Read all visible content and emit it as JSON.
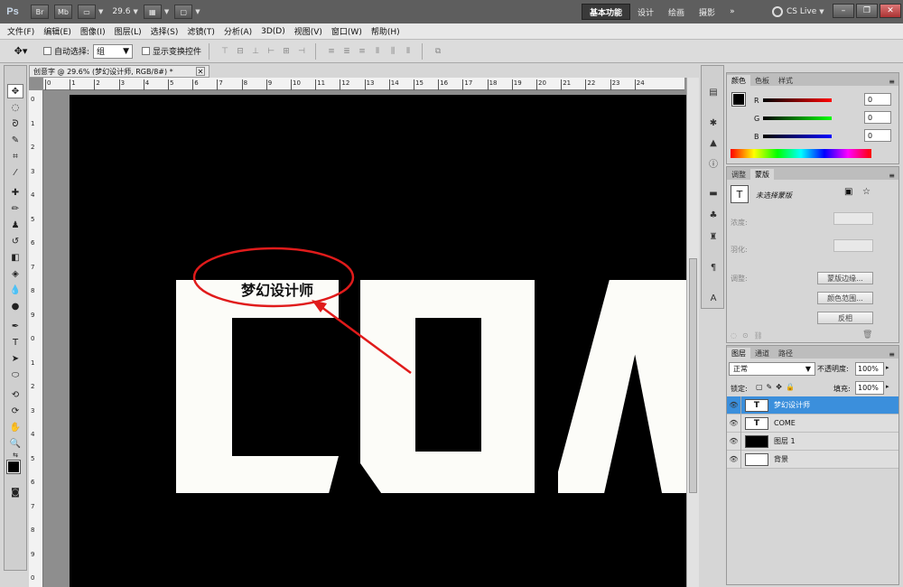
{
  "appbar": {
    "logo": "Ps",
    "btn_br": "Br",
    "btn_mb": "Mb",
    "zoom": "29.6",
    "workspaces": [
      "基本功能",
      "设计",
      "绘画",
      "摄影"
    ],
    "more": "»",
    "cs_live": "CS Live"
  },
  "menubar": [
    "文件(F)",
    "编辑(E)",
    "图像(I)",
    "图层(L)",
    "选择(S)",
    "滤镜(T)",
    "分析(A)",
    "3D(D)",
    "视图(V)",
    "窗口(W)",
    "帮助(H)"
  ],
  "options": {
    "auto_select_label": "自动选择:",
    "auto_select_value": "组",
    "show_transform_label": "显示变换控件"
  },
  "document": {
    "tab_title": "创意字 @ 29.6% (梦幻设计师, RGB/8#) *",
    "hruler_ticks": [
      "0",
      "1",
      "2",
      "3",
      "4",
      "5",
      "6",
      "7",
      "8",
      "9",
      "10",
      "11",
      "12",
      "13",
      "14",
      "15",
      "16",
      "17",
      "18",
      "19",
      "20",
      "21",
      "22",
      "23",
      "24"
    ],
    "vruler_ticks": [
      "0",
      "1",
      "2",
      "3",
      "4",
      "5",
      "6",
      "7",
      "8",
      "9",
      "0",
      "1",
      "2",
      "3",
      "4",
      "5",
      "6",
      "7",
      "8",
      "9",
      "0"
    ],
    "annotation_text": "梦幻设计师"
  },
  "color_panel": {
    "tabs": [
      "颜色",
      "色板",
      "样式"
    ],
    "r_label": "R",
    "r_value": "0",
    "g_label": "G",
    "g_value": "0",
    "b_label": "B",
    "b_value": "0"
  },
  "mask_panel": {
    "tabs": [
      "调整",
      "蒙版"
    ],
    "title": "未选择蒙版",
    "density": "浓度:",
    "feather": "羽化:",
    "adjust": "调整:",
    "btn_edge": "蒙版边缘...",
    "btn_range": "颜色范围...",
    "btn_invert": "反相"
  },
  "layers_panel": {
    "tabs": [
      "图层",
      "通道",
      "路径"
    ],
    "blend_mode": "正常",
    "opacity_label": "不透明度:",
    "opacity_value": "100%",
    "lock_label": "锁定:",
    "fill_label": "填充:",
    "fill_value": "100%",
    "layers": [
      {
        "name": "梦幻设计师",
        "thumb": "T"
      },
      {
        "name": "COME",
        "thumb": "T"
      },
      {
        "name": "图层 1",
        "thumb": ""
      },
      {
        "name": "背景",
        "thumb": ""
      }
    ]
  },
  "colors": {
    "canvas": "#000000",
    "shape": "#fcfcf8",
    "annotation": "#e01b1b",
    "selection": "#3b8fdc"
  }
}
